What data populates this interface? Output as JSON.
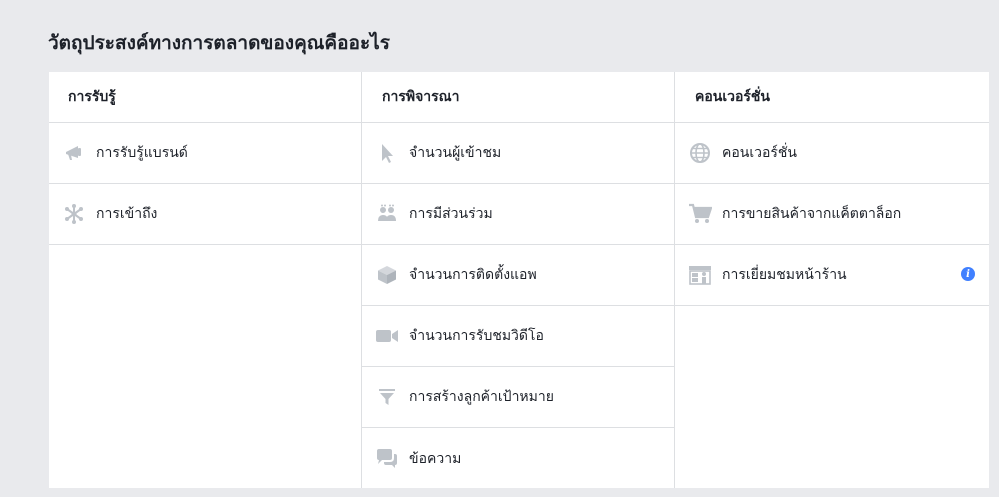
{
  "page": {
    "title": "วัตถุประสงค์ทางการตลาดของคุณคืออะไร"
  },
  "columns": [
    {
      "header": "การรับรู้",
      "items": [
        {
          "label": "การรับรู้แบรนด์",
          "icon": "megaphone-icon"
        },
        {
          "label": "การเข้าถึง",
          "icon": "reach-burst-icon"
        }
      ]
    },
    {
      "header": "การพิจารณา",
      "items": [
        {
          "label": "จำนวนผู้เข้าชม",
          "icon": "cursor-icon"
        },
        {
          "label": "การมีส่วนร่วม",
          "icon": "people-icon"
        },
        {
          "label": "จำนวนการติดตั้งแอพ",
          "icon": "cube-icon"
        },
        {
          "label": "จำนวนการรับชมวิดีโอ",
          "icon": "video-camera-icon"
        },
        {
          "label": "การสร้างลูกค้าเป้าหมาย",
          "icon": "funnel-icon"
        },
        {
          "label": "ข้อความ",
          "icon": "chat-bubbles-icon"
        }
      ]
    },
    {
      "header": "คอนเวอร์ชั่น",
      "items": [
        {
          "label": "คอนเวอร์ชั่น",
          "icon": "globe-icon"
        },
        {
          "label": "การขายสินค้าจากแค็ตตาล็อก",
          "icon": "shopping-cart-icon"
        },
        {
          "label": "การเยี่ยมชมหน้าร้าน",
          "icon": "storefront-icon",
          "info_icon": "info-icon"
        }
      ]
    }
  ],
  "colors": {
    "icon": "#bec3c9",
    "info": "#4080ff",
    "border": "#dddfe2",
    "background": "#e9eaed"
  }
}
